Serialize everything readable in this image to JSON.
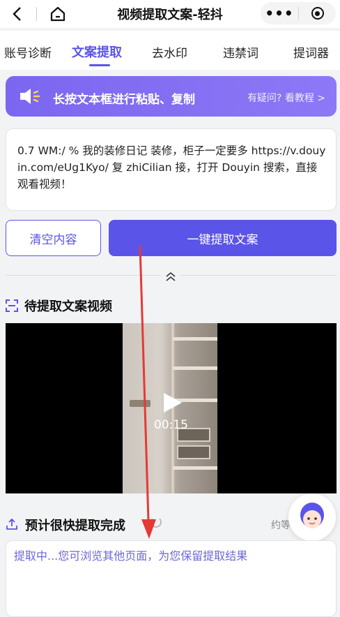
{
  "header": {
    "title": "视频提取文案-轻抖",
    "more_label": "•••"
  },
  "tabs": [
    {
      "label": "账号诊断",
      "active": false
    },
    {
      "label": "文案提取",
      "active": true
    },
    {
      "label": "去水印",
      "active": false
    },
    {
      "label": "违禁词",
      "active": false
    },
    {
      "label": "提词器",
      "active": false
    }
  ],
  "banner": {
    "text": "长按文本框进行粘贴、复制",
    "help_link": "有疑问? 看教程 >"
  },
  "input": {
    "value": "0.7 WM:/ % 我的装修日记 装修，柜子一定要多 https://v.douyin.com/eUg1Kyo/ 复 zhiCilian 接，打开 Douyin 搜索，直接观看视频！"
  },
  "buttons": {
    "clear_label": "清空内容",
    "extract_label": "一键提取文案"
  },
  "video_section": {
    "title": "待提取文案视频",
    "duration": "00:15"
  },
  "estimate": {
    "text": "预计很快提取完成",
    "right_text": "约等"
  },
  "result": {
    "placeholder": "提取中...您可浏览其他页面，为您保留提取结果"
  },
  "colors": {
    "accent": "#5b54e8",
    "banner": "#8170f2",
    "annotation": "#e53935"
  }
}
